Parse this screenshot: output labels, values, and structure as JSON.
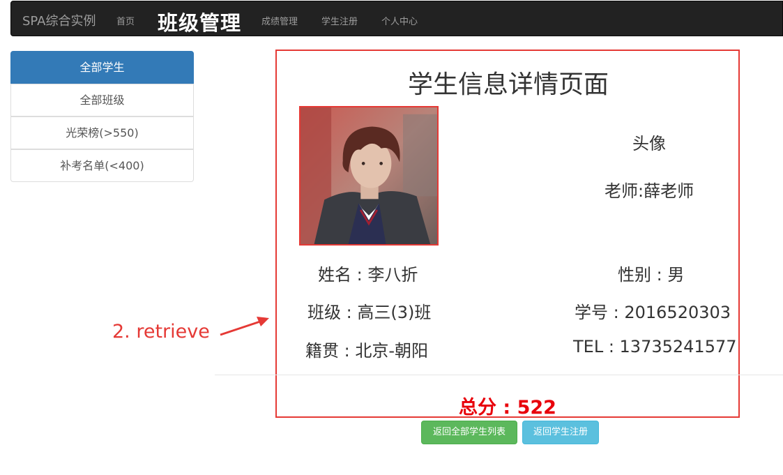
{
  "navbar": {
    "brand": "SPA综合实例",
    "items": [
      "首页",
      "班级管理",
      "成绩管理",
      "学生注册",
      "个人中心"
    ]
  },
  "sidebar": {
    "items": [
      "全部学生",
      "全部班级",
      "光荣榜(>550)",
      "补考名单(<400)"
    ]
  },
  "detail": {
    "title": "学生信息详情页面",
    "avatar_label": "头像",
    "teacher": "老师:薛老师",
    "name": "姓名 : 李八折",
    "gender": "性别 : 男",
    "class": "班级 : 高三(3)班",
    "student_no": "学号 : 2016520303",
    "hometown": "籍贯 : 北京-朝阳",
    "tel": "TEL : 13735241577",
    "total": "总分 : 522"
  },
  "buttons": {
    "back_list": "返回全部学生列表",
    "back_register": "返回学生注册"
  },
  "annotation": {
    "text": "2. retrieve"
  },
  "colors": {
    "navbar_bg": "#222222",
    "primary": "#337ab7",
    "success": "#5cb85c",
    "info": "#5bc0de",
    "annotation_red": "#e53935"
  }
}
